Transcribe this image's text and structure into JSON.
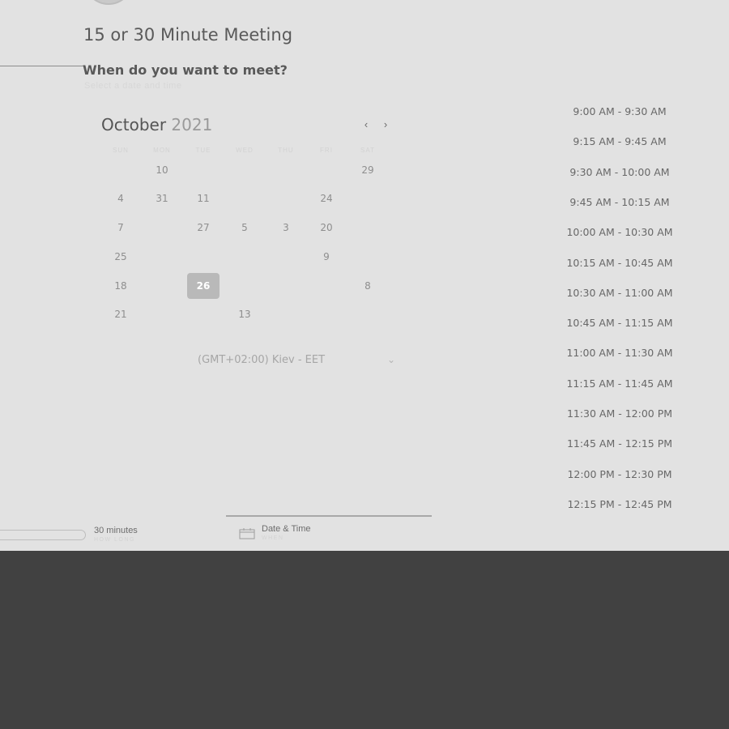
{
  "meeting": {
    "title": "15 or 30 Minute Meeting",
    "question": "When do you want to meet?",
    "hint": "Select a date and time"
  },
  "calendar": {
    "month": "October",
    "year": "2021",
    "prev_icon": "chevron-left-icon",
    "next_icon": "chevron-right-icon",
    "weekdays": [
      "SUN",
      "MON",
      "TUE",
      "WED",
      "THU",
      "FRI",
      "SAT"
    ],
    "days": [
      [
        "",
        "10",
        "",
        "",
        "",
        "",
        "29"
      ],
      [
        "4",
        "31",
        "11",
        "",
        "",
        "24",
        ""
      ],
      [
        "7",
        "",
        "27",
        "5",
        "3",
        "20",
        ""
      ],
      [
        "25",
        "",
        "",
        "",
        "",
        "9",
        ""
      ],
      [
        "18",
        "",
        "26",
        "",
        "",
        "",
        "8"
      ],
      [
        "21",
        "",
        "",
        "13",
        "",
        "",
        ""
      ]
    ],
    "selected_day": "26",
    "timezone": "(GMT+02:00) Kiev - EET"
  },
  "time_slots": [
    "9:00 AM - 9:30 AM",
    "9:15 AM - 9:45 AM",
    "9:30 AM - 10:00 AM",
    "9:45 AM - 10:15 AM",
    "10:00 AM - 10:30 AM",
    "10:15 AM - 10:45 AM",
    "10:30 AM - 11:00 AM",
    "10:45 AM - 11:15 AM",
    "11:00 AM - 11:30 AM",
    "11:15 AM - 11:45 AM",
    "11:30 AM - 12:00 PM",
    "11:45 AM - 12:15 PM",
    "12:00 PM - 12:30 PM",
    "12:15 PM - 12:45 PM"
  ],
  "steps": [
    {
      "title": "30 minutes",
      "sub": "HOW LONG"
    },
    {
      "title": "Date & Time",
      "sub": "WHEN",
      "icon": "calendar-icon"
    }
  ],
  "colors": {
    "panel": "#e2e2e2",
    "backdrop": "#414141",
    "selected_day": "#b9b9b9"
  }
}
